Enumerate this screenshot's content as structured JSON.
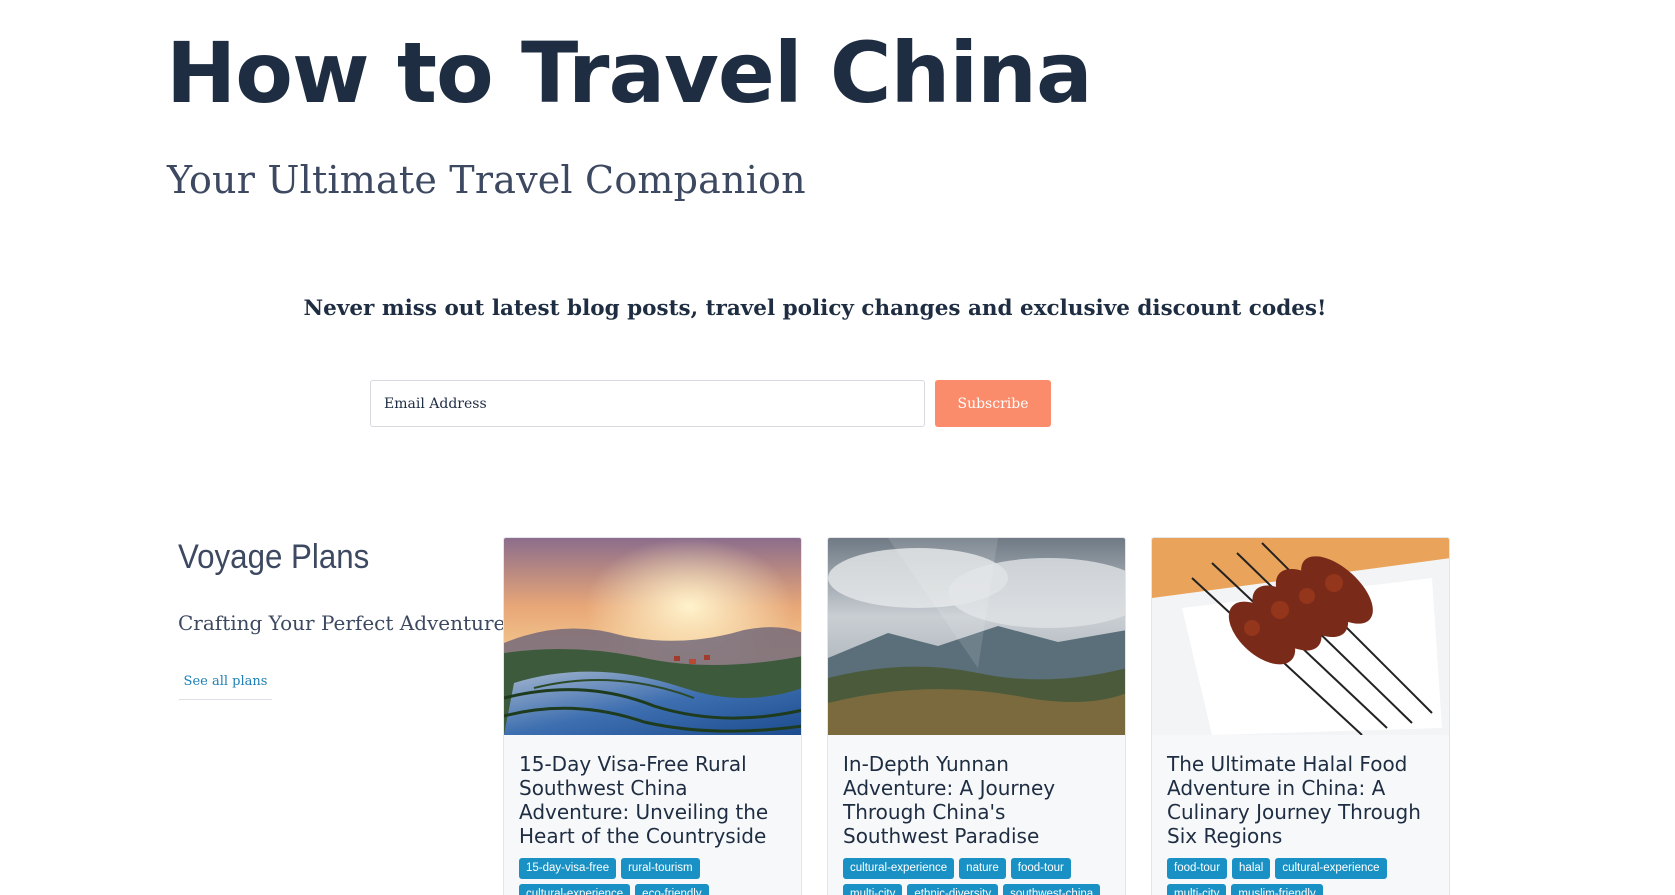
{
  "site": {
    "title": "How to Travel China",
    "tagline": "Your Ultimate Travel Companion"
  },
  "newsletter": {
    "heading": "Never miss out latest blog posts, travel policy changes and exclusive discount codes!",
    "email_placeholder": "Email Address",
    "subscribe_label": "Subscribe",
    "button_color": "#fb8c6b"
  },
  "voyage": {
    "title": "Voyage Plans",
    "subtitle": "Crafting Your Perfect Adventure",
    "see_all_label": "See all plans",
    "cards": [
      {
        "title": "15-Day Visa-Free Rural Southwest China Adventure: Unveiling the Heart of the Countryside",
        "image": "rice-terraces-sunrise-photo",
        "tags": [
          "15-day-visa-free",
          "rural-tourism",
          "cultural-experience",
          "eco-friendly"
        ]
      },
      {
        "title": "In-Depth Yunnan Adventure: A Journey Through China's Southwest Paradise",
        "image": "yunnan-mountain-valley-photo",
        "tags": [
          "cultural-experience",
          "nature",
          "food-tour",
          "multi-city",
          "ethnic-diversity",
          "southwest-china"
        ]
      },
      {
        "title": "The Ultimate Halal Food Adventure in China: A Culinary Journey Through Six Regions",
        "image": "lamb-skewers-photo",
        "tags": [
          "food-tour",
          "halal",
          "cultural-experience",
          "multi-city",
          "muslim-friendly"
        ]
      }
    ]
  },
  "colors": {
    "heading": "#1e2d42",
    "tag": "#1a91c4",
    "link": "#1d7fb5"
  }
}
